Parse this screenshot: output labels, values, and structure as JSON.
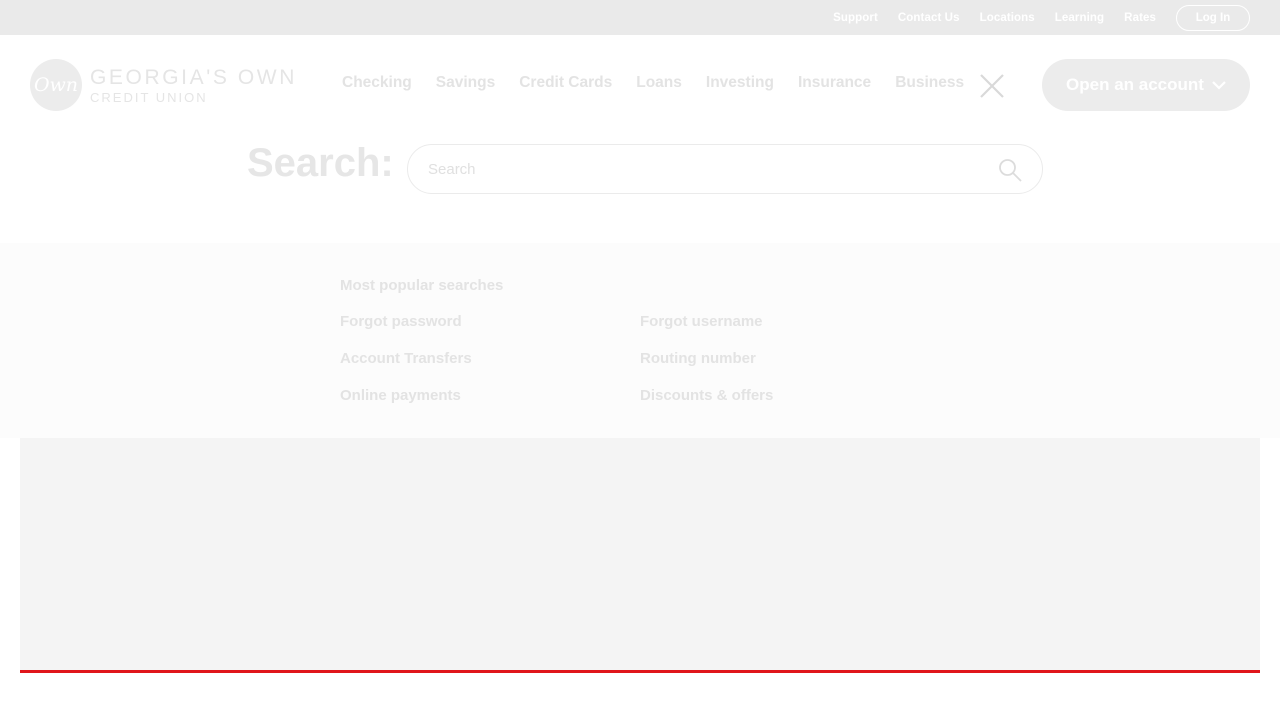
{
  "utility_nav": {
    "links": [
      "Support",
      "Contact Us",
      "Locations",
      "Learning",
      "Rates"
    ],
    "login_label": "Log In"
  },
  "logo": {
    "mark": "Own",
    "line1": "GEORGIA'S OWN",
    "line2": "CREDIT UNION"
  },
  "main_nav": {
    "items": [
      "Checking",
      "Savings",
      "Credit Cards",
      "Loans",
      "Investing",
      "Insurance",
      "Business"
    ]
  },
  "close_icon": "close-icon",
  "open_account": {
    "label": "Open an account",
    "icon": "chevron-down-icon"
  },
  "search": {
    "label": "Search:",
    "placeholder": "Search",
    "value": "",
    "icon": "search-icon"
  },
  "popular": {
    "title": "Most popular searches",
    "links": [
      "Forgot password",
      "Forgot username",
      "Account Transfers",
      "Routing number",
      "Online payments",
      "Discounts & offers"
    ]
  },
  "colors": {
    "accent_rule": "#e0161b",
    "overlay_gray": "#eaeaea"
  }
}
